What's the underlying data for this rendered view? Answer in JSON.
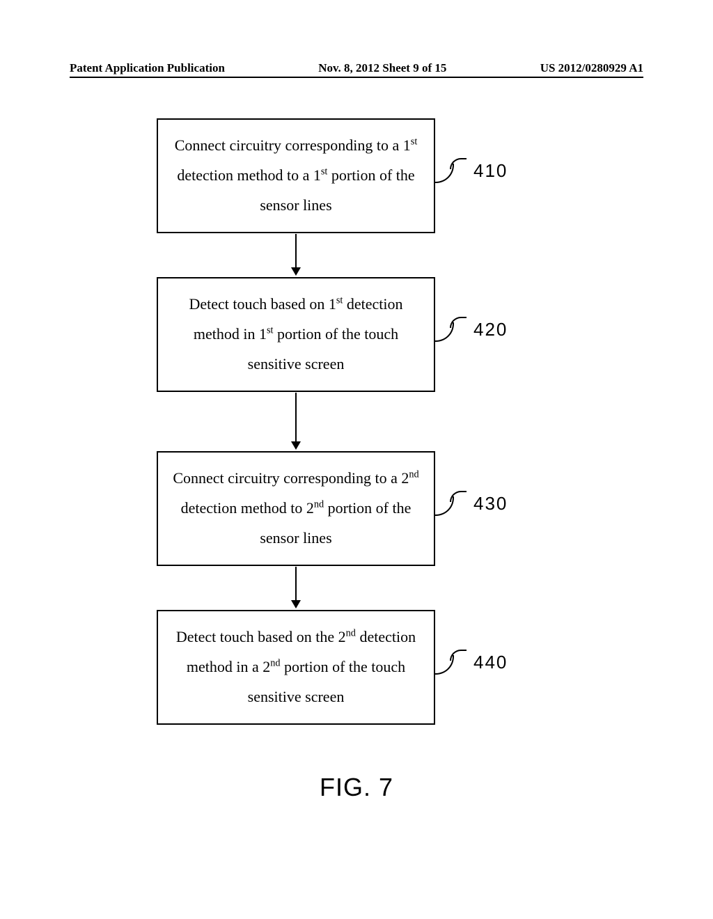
{
  "header": {
    "left": "Patent Application Publication",
    "center": "Nov. 8, 2012  Sheet 9 of 15",
    "right": "US 2012/0280929 A1"
  },
  "chart_data": {
    "type": "flowchart",
    "nodes": [
      {
        "id": "410",
        "label_html": "Connect circuitry corresponding to a 1<sup>st</sup> detection method to a 1<sup>st</sup> portion of the sensor lines",
        "ref": "410"
      },
      {
        "id": "420",
        "label_html": "Detect touch based on 1<sup>st</sup> detection method in  1<sup>st</sup> portion of the touch sensitive screen",
        "ref": "420"
      },
      {
        "id": "430",
        "label_html": "Connect circuitry corresponding to a 2<sup>nd</sup> detection method to  2<sup>nd</sup>  portion of the sensor lines",
        "ref": "430"
      },
      {
        "id": "440",
        "label_html": "Detect touch based on the 2<sup>nd</sup> detection method in a 2<sup>nd</sup> portion of the touch sensitive screen",
        "ref": "440"
      }
    ],
    "edges": [
      {
        "from": "410",
        "to": "420"
      },
      {
        "from": "420",
        "to": "430"
      },
      {
        "from": "430",
        "to": "440"
      }
    ],
    "title": "FIG. 7"
  },
  "boxes": {
    "b0": {
      "ref": "410"
    },
    "b1": {
      "ref": "420"
    },
    "b2": {
      "ref": "430"
    },
    "b3": {
      "ref": "440"
    }
  },
  "figure_label": "FIG. 7"
}
